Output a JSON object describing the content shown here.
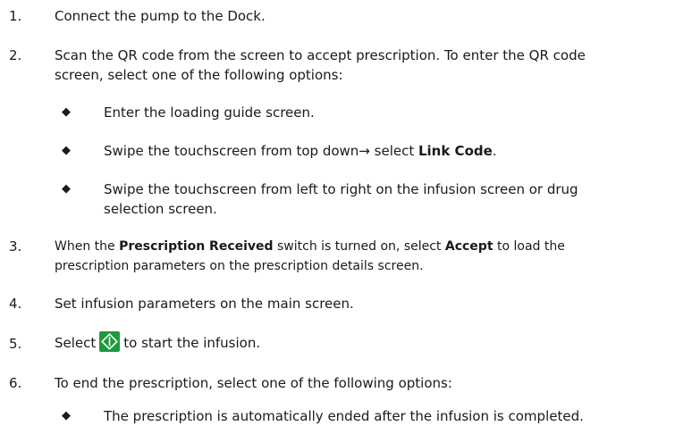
{
  "steps": [
    {
      "num": "1.",
      "text": "Connect the pump to the Dock."
    },
    {
      "num": "2.",
      "line1": "Scan the QR code from the screen to accept prescription. To enter the QR code",
      "line2": "screen, select one of the following options:",
      "bullets": [
        {
          "text": "Enter the loading guide screen."
        },
        {
          "pre": "Swipe the touchscreen from top down→ select ",
          "bold": "Link Code",
          "post": "."
        },
        {
          "line1": "Swipe the touchscreen from left to right on the infusion screen or drug",
          "line2": "selection screen."
        }
      ]
    },
    {
      "num": "3.",
      "pre": "When the ",
      "bold1": "Prescription Received",
      "mid": " switch is turned on, select ",
      "bold2": "Accept",
      "post": " to load the",
      "line2": "prescription parameters on the prescription details screen."
    },
    {
      "num": "4.",
      "text": "Set infusion parameters on the main screen."
    },
    {
      "num": "5.",
      "pre": "Select",
      "icon": "start-infusion-icon",
      "post": "to start the infusion."
    },
    {
      "num": "6.",
      "text": "To end the prescription, select one of the following options:",
      "bullets": [
        {
          "text": "The prescription is automatically ended after the infusion is completed."
        }
      ]
    }
  ],
  "bullet_symbol": "◆",
  "colors": {
    "icon_bg": "#1e9a3c",
    "icon_fg": "#ffffff",
    "text": "#1a1a1a"
  }
}
